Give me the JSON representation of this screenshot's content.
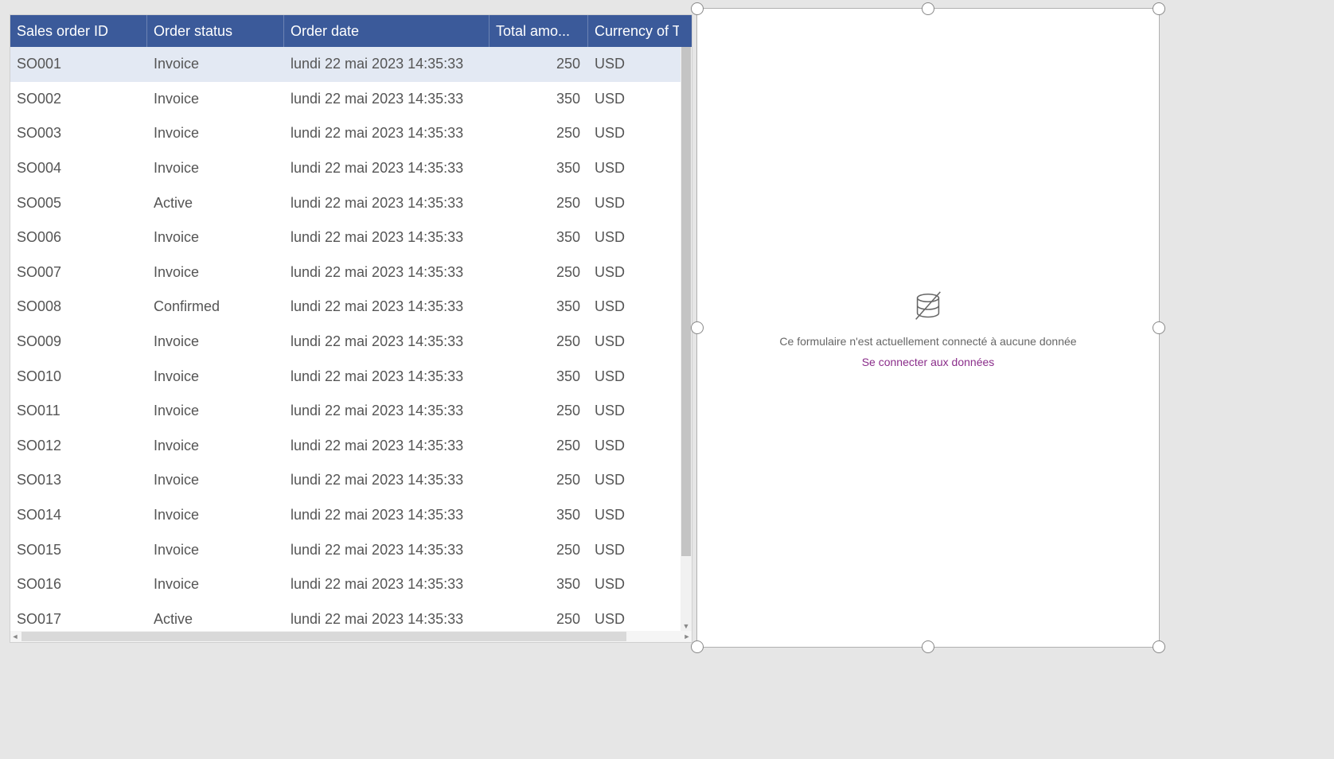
{
  "table": {
    "columns": [
      {
        "label": "Sales order ID"
      },
      {
        "label": "Order status"
      },
      {
        "label": "Order date"
      },
      {
        "label": "Total amo..."
      },
      {
        "label": "Currency of T"
      }
    ],
    "rows": [
      {
        "id": "SO001",
        "status": "Invoice",
        "date": "lundi 22 mai 2023 14:35:33",
        "amount": "250",
        "currency": "USD",
        "selected": true
      },
      {
        "id": "SO002",
        "status": "Invoice",
        "date": "lundi 22 mai 2023 14:35:33",
        "amount": "350",
        "currency": "USD"
      },
      {
        "id": "SO003",
        "status": "Invoice",
        "date": "lundi 22 mai 2023 14:35:33",
        "amount": "250",
        "currency": "USD"
      },
      {
        "id": "SO004",
        "status": "Invoice",
        "date": "lundi 22 mai 2023 14:35:33",
        "amount": "350",
        "currency": "USD"
      },
      {
        "id": "SO005",
        "status": "Active",
        "date": "lundi 22 mai 2023 14:35:33",
        "amount": "250",
        "currency": "USD"
      },
      {
        "id": "SO006",
        "status": "Invoice",
        "date": "lundi 22 mai 2023 14:35:33",
        "amount": "350",
        "currency": "USD"
      },
      {
        "id": "SO007",
        "status": "Invoice",
        "date": "lundi 22 mai 2023 14:35:33",
        "amount": "250",
        "currency": "USD"
      },
      {
        "id": "SO008",
        "status": "Confirmed",
        "date": "lundi 22 mai 2023 14:35:33",
        "amount": "350",
        "currency": "USD"
      },
      {
        "id": "SO009",
        "status": "Invoice",
        "date": "lundi 22 mai 2023 14:35:33",
        "amount": "250",
        "currency": "USD"
      },
      {
        "id": "SO010",
        "status": "Invoice",
        "date": "lundi 22 mai 2023 14:35:33",
        "amount": "350",
        "currency": "USD"
      },
      {
        "id": "SO011",
        "status": "Invoice",
        "date": "lundi 22 mai 2023 14:35:33",
        "amount": "250",
        "currency": "USD"
      },
      {
        "id": "SO012",
        "status": "Invoice",
        "date": "lundi 22 mai 2023 14:35:33",
        "amount": "250",
        "currency": "USD"
      },
      {
        "id": "SO013",
        "status": "Invoice",
        "date": "lundi 22 mai 2023 14:35:33",
        "amount": "250",
        "currency": "USD"
      },
      {
        "id": "SO014",
        "status": "Invoice",
        "date": "lundi 22 mai 2023 14:35:33",
        "amount": "350",
        "currency": "USD"
      },
      {
        "id": "SO015",
        "status": "Invoice",
        "date": "lundi 22 mai 2023 14:35:33",
        "amount": "250",
        "currency": "USD"
      },
      {
        "id": "SO016",
        "status": "Invoice",
        "date": "lundi 22 mai 2023 14:35:33",
        "amount": "350",
        "currency": "USD"
      },
      {
        "id": "SO017",
        "status": "Active",
        "date": "lundi 22 mai 2023 14:35:33",
        "amount": "250",
        "currency": "USD"
      }
    ]
  },
  "form": {
    "empty_message": "Ce formulaire n'est actuellement connecté à aucune donnée",
    "connect_link": "Se connecter aux données"
  }
}
